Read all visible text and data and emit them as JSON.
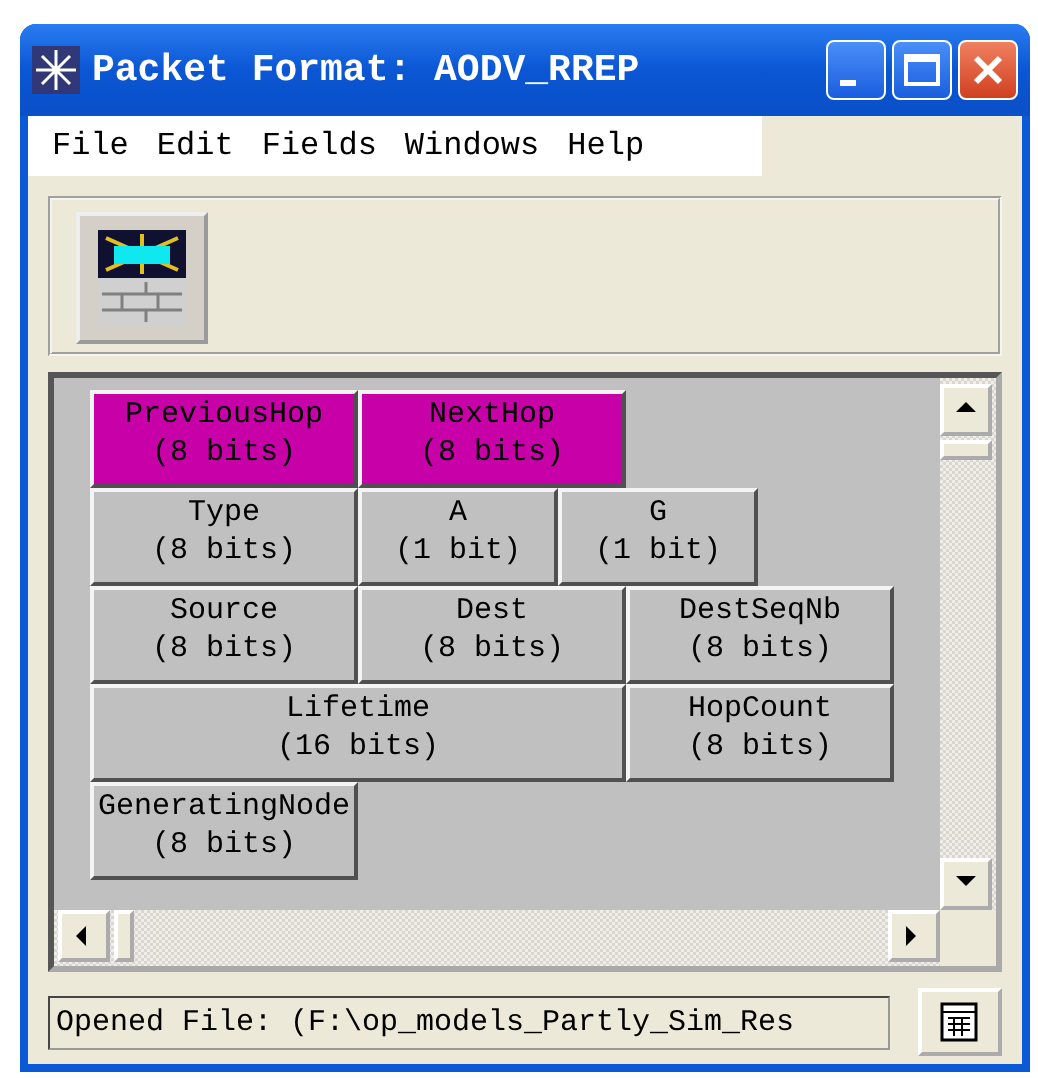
{
  "window": {
    "title": "Packet Format: AODV_RREP"
  },
  "menu": [
    "File",
    "Edit",
    "Fields",
    "Windows",
    "Help"
  ],
  "fields": [
    [
      {
        "name": "PreviousHop",
        "size": "(8 bits)",
        "kind": "byte",
        "selected": true
      },
      {
        "name": "NextHop",
        "size": "(8 bits)",
        "kind": "byte",
        "selected": true
      }
    ],
    [
      {
        "name": "Type",
        "size": "(8 bits)",
        "kind": "byte",
        "selected": false
      },
      {
        "name": "A",
        "size": "(1 bit)",
        "kind": "bit",
        "selected": false
      },
      {
        "name": "G",
        "size": "(1 bit)",
        "kind": "bit",
        "selected": false
      }
    ],
    [
      {
        "name": "Source",
        "size": "(8 bits)",
        "kind": "byte",
        "selected": false
      },
      {
        "name": "Dest",
        "size": "(8 bits)",
        "kind": "byte",
        "selected": false
      },
      {
        "name": "DestSeqNb",
        "size": "(8 bits)",
        "kind": "byte",
        "selected": false
      }
    ],
    [
      {
        "name": "Lifetime",
        "size": "(16 bits)",
        "kind": "word",
        "selected": false
      },
      {
        "name": "HopCount",
        "size": "(8 bits)",
        "kind": "byte",
        "selected": false
      }
    ],
    [
      {
        "name": "GeneratingNode",
        "size": "(8 bits)",
        "kind": "byte",
        "selected": false
      }
    ]
  ],
  "status_bar": {
    "text": "Opened File:  (F:\\op_models_Partly_Sim_Res"
  }
}
